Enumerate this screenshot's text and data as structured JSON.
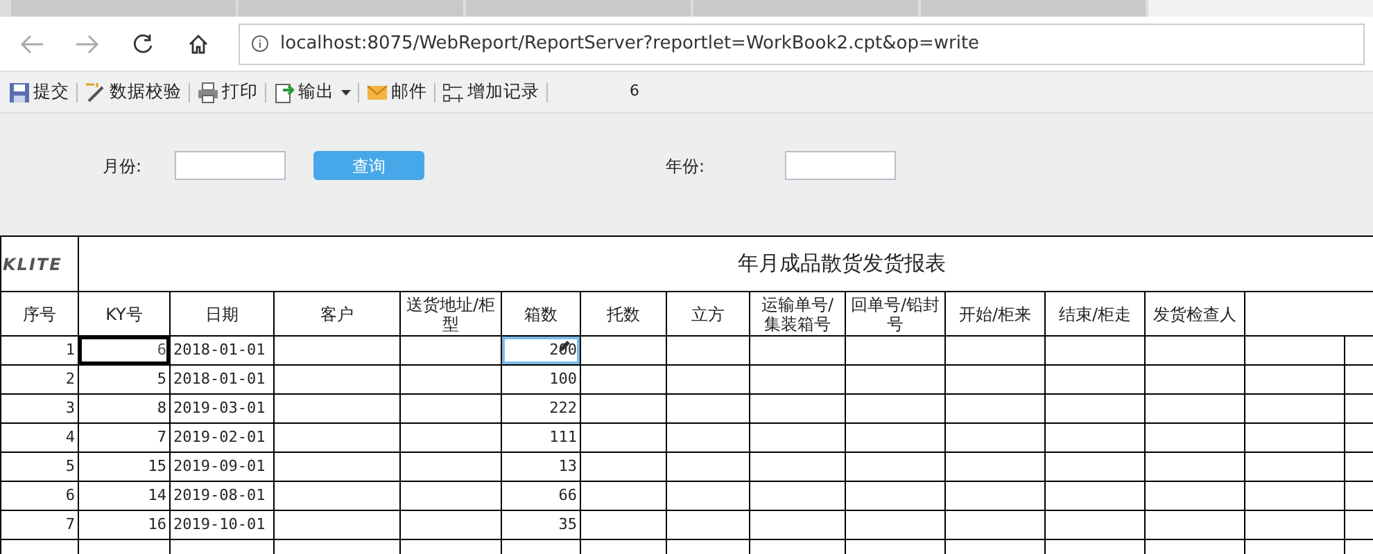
{
  "browser": {
    "tabs": [
      {
        "selected": false
      },
      {
        "selected": false
      },
      {
        "selected": false
      },
      {
        "selected": false
      },
      {
        "selected": false
      },
      {
        "selected": true
      }
    ],
    "address": "localhost:8075/WebReport/ReportServer?reportlet=WorkBook2.cpt&op=write"
  },
  "toolbar": [
    {
      "kind": "save",
      "label": "提交"
    },
    {
      "kind": "check",
      "label": "数据校验"
    },
    {
      "kind": "print",
      "label": "打印"
    },
    {
      "kind": "export",
      "label": "输出",
      "dropdown": true
    },
    {
      "kind": "mail",
      "label": "邮件"
    },
    {
      "kind": "addrow",
      "label": "增加记录"
    }
  ],
  "toolbar_page": "6",
  "form": {
    "month_label": "月份:",
    "query_button": "查询",
    "year_label": "年份:"
  },
  "report": {
    "logo": "KLITE",
    "title": "年月成品散货发货报表",
    "columns": [
      "序号",
      "KY号",
      "日期",
      "客户",
      "送货地址/柜型",
      "箱数",
      "托数",
      "立方",
      "运输单号/集装箱号",
      "回单号/铅封号",
      "开始/柜来",
      "结束/柜走",
      "发货检查人"
    ],
    "rows": [
      {
        "no": "1",
        "ky": "6",
        "date": "2018-01-01",
        "boxes": "200",
        "ky_selected": true,
        "boxes_editing": true
      },
      {
        "no": "2",
        "ky": "5",
        "date": "2018-01-01",
        "boxes": "100",
        "ky_selected": false,
        "boxes_editing": false
      },
      {
        "no": "3",
        "ky": "8",
        "date": "2019-03-01",
        "boxes": "222",
        "ky_selected": false,
        "boxes_editing": false
      },
      {
        "no": "4",
        "ky": "7",
        "date": "2019-02-01",
        "boxes": "111",
        "ky_selected": false,
        "boxes_editing": false
      },
      {
        "no": "5",
        "ky": "15",
        "date": "2019-09-01",
        "boxes": "13",
        "ky_selected": false,
        "boxes_editing": false
      },
      {
        "no": "6",
        "ky": "14",
        "date": "2019-08-01",
        "boxes": "66",
        "ky_selected": false,
        "boxes_editing": false
      },
      {
        "no": "7",
        "ky": "16",
        "date": "2019-10-01",
        "boxes": "35",
        "ky_selected": false,
        "boxes_editing": false
      }
    ]
  }
}
